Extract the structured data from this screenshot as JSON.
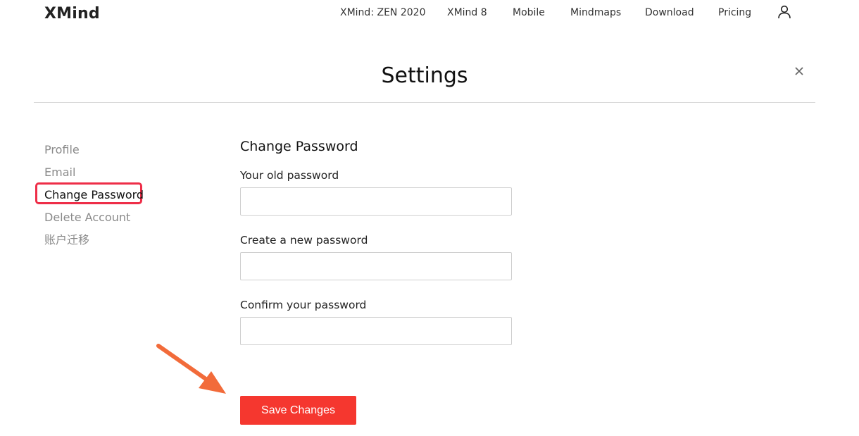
{
  "header": {
    "logo": "XMind",
    "nav": [
      {
        "label": "XMind: ZEN 2020"
      },
      {
        "label": "XMind 8"
      },
      {
        "label": "Mobile"
      },
      {
        "label": "Mindmaps"
      },
      {
        "label": "Download"
      },
      {
        "label": "Pricing"
      }
    ],
    "user_icon": "user-icon"
  },
  "page": {
    "title": "Settings",
    "close_icon": "close-icon"
  },
  "sidebar": {
    "items": [
      {
        "label": "Profile",
        "active": false
      },
      {
        "label": "Email",
        "active": false
      },
      {
        "label": "Change Password",
        "active": true
      },
      {
        "label": "Delete Account",
        "active": false
      },
      {
        "label": "账户迁移",
        "active": false
      }
    ],
    "highlight_color": "#ee2e48"
  },
  "form": {
    "title": "Change Password",
    "fields": [
      {
        "label": "Your old password",
        "value": "",
        "placeholder": ""
      },
      {
        "label": "Create a new password",
        "value": "",
        "placeholder": ""
      },
      {
        "label": "Confirm your password",
        "value": "",
        "placeholder": ""
      }
    ],
    "save_label": "Save Changes",
    "save_color": "#f5372f"
  },
  "annotation": {
    "arrow_icon": "arrow-icon",
    "arrow_color": "#f26b3a"
  }
}
